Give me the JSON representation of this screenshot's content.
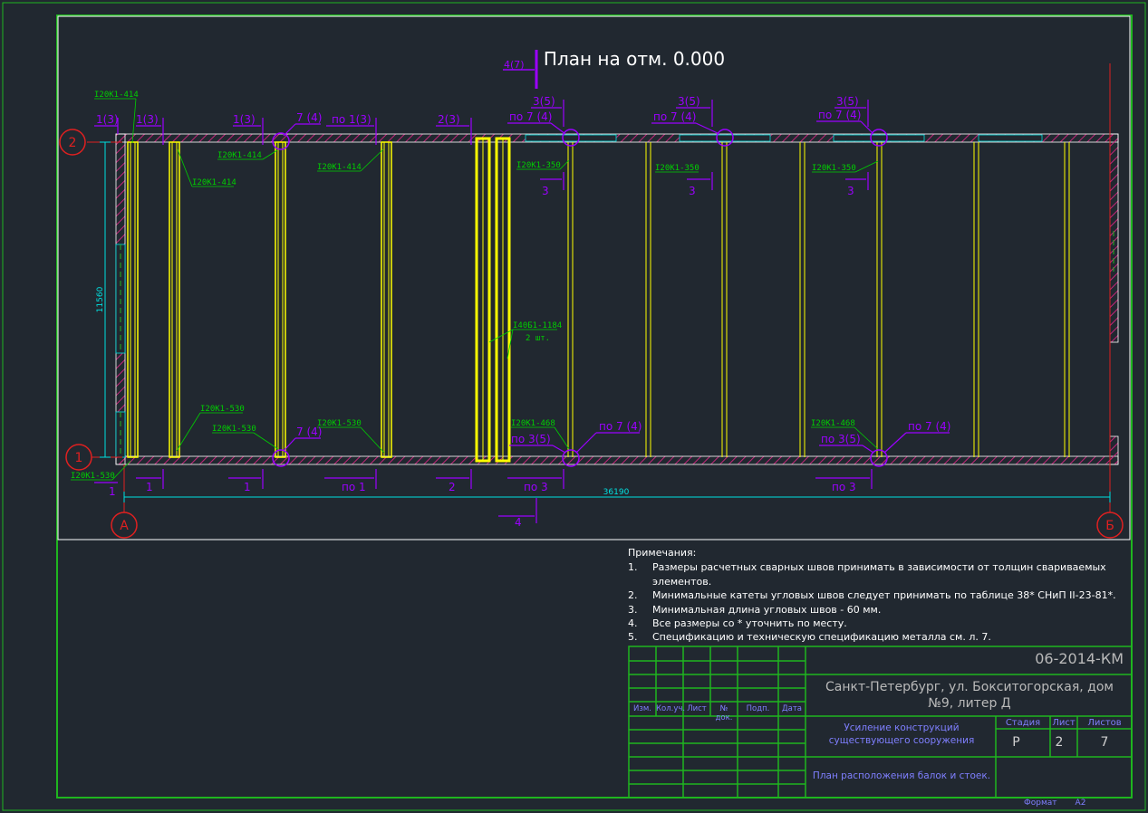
{
  "plan_title": "План на отм. 0.000",
  "axis_labels": {
    "row2": "2",
    "row1": "1",
    "colA": "А",
    "colB": "Б"
  },
  "dimensions": {
    "height": "11560",
    "width": "36190"
  },
  "beam_labels": {
    "b414_top": "I20K1-414",
    "b414_a": "I20K1-414",
    "b414_b": "I20K1-414",
    "b414_c": "I20K1-414",
    "b530_a": "I20K1-530",
    "b530_b": "I20K1-530",
    "b530_c": "I20K1-530",
    "b530_d": "I20K1-530",
    "b350_a": "I20K1-350",
    "b350_b": "I20K1-350",
    "b350_c": "I20K1-350",
    "b468_a": "I20K1-468",
    "b468_b": "I20K1-468",
    "b4061": "I40Б1-1184",
    "b4061_qty": "2 шт."
  },
  "weld_marks": {
    "top_1": "1(3)",
    "top_1b": "1(3)",
    "top_1c": "1(3)",
    "top_7": "7 (4)",
    "top_po1": "по 1(3)",
    "top_2": "2(3)",
    "top_47": "4(7)",
    "top_35a": "3(5)",
    "top_po7a": "по 7 (4)",
    "top_35b": "3(5)",
    "top_po7b": "по 7 (4)",
    "top_35c": "3(5)",
    "top_po7c": "по 7 (4)",
    "mid_3a": "3",
    "mid_3b": "3",
    "mid_3c": "3",
    "bot_7a": "7 (4)",
    "bot_po35a": "по 3(5)",
    "bot_po7a": "по 7 (4)",
    "bot_po35b": "по 3(5)",
    "bot_po7b": "по 7 (4)",
    "bot_1a": "1",
    "bot_1b": "1",
    "bot_1c": "1",
    "bot_po1": "по 1",
    "bot_2": "2",
    "bot_po3a": "по 3",
    "bot_po3b": "по 3",
    "bot_4": "4"
  },
  "notes": {
    "title": "Примечания:",
    "items": [
      {
        "num": "1.",
        "text": "Размеры расчетных сварных швов принимать в зависимости  от толщин свариваемых элементов."
      },
      {
        "num": "2.",
        "text": "Минимальные катеты угловых швов следует принимать по таблице 38* СНиП II-23-81*."
      },
      {
        "num": "3.",
        "text": "Минимальная длина угловых швов - 60 мм."
      },
      {
        "num": "4.",
        "text": "Все размеры со * уточнить по месту."
      },
      {
        "num": "5.",
        "text": "Спецификацию и техническую спецификацию металла см. л. 7."
      }
    ]
  },
  "title_block": {
    "code": "06-2014-КМ",
    "address": "Санкт-Петербург, ул. Бокситогорская, дом №9, литер Д",
    "object": "Усиление конструкций существующего сооружения",
    "sheet_name": "План расположения балок и стоек.",
    "col_headers": [
      "Изм.",
      "Кол.уч.",
      "Лист",
      "№ док.",
      "Подп.",
      "Дата"
    ],
    "stage_label": "Стадия",
    "sheet_label": "Лист",
    "sheets_label": "Листов",
    "stage": "Р",
    "sheet": "2",
    "sheets": "7",
    "format_label": "Формат",
    "format": "А2"
  },
  "colors": {
    "background": "#212830",
    "frame": "#1fb51f",
    "beam": "#ffff00",
    "weld": "#9b00ff",
    "wall_hatch": "#c4267a",
    "dimension": "#00e0e0",
    "axis": "#e02020",
    "label": "#00d000"
  }
}
